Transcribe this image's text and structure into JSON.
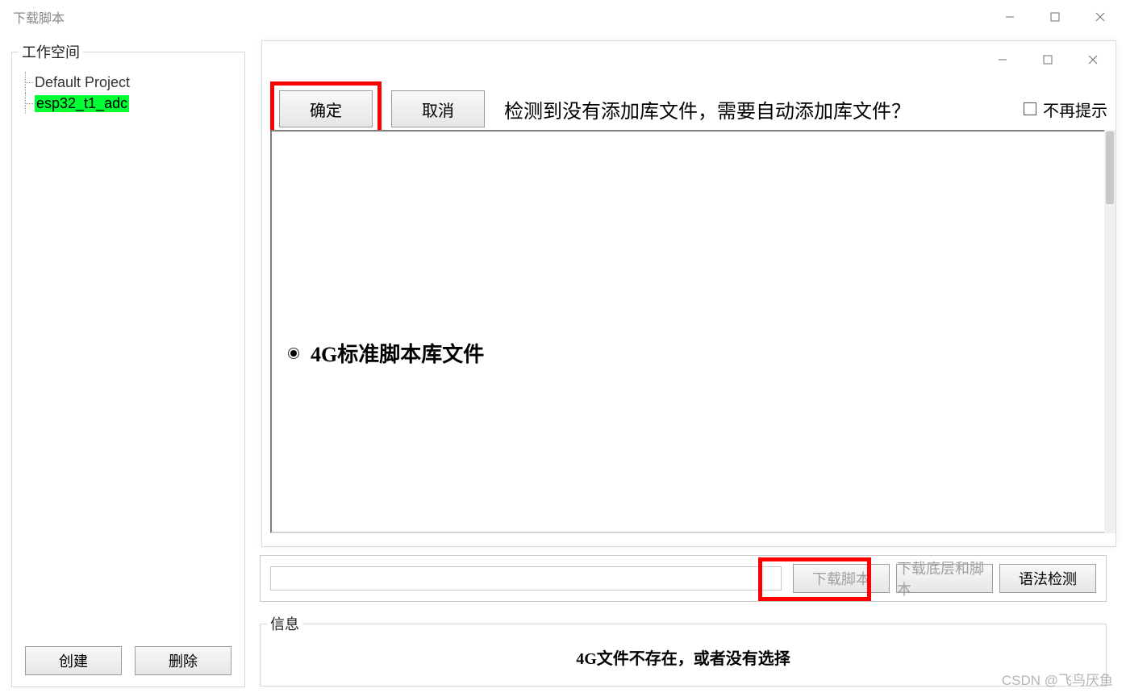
{
  "window": {
    "title": "下载脚本"
  },
  "workspace": {
    "legend": "工作空间",
    "tree": {
      "root": "Default Project",
      "child": "esp32_t1_adc"
    },
    "buttons": {
      "create": "创建",
      "delete": "删除"
    }
  },
  "bottombar": {
    "download_script": "下载脚本",
    "download_base_script": "下载底层和脚本",
    "syntax_check": "语法检测"
  },
  "info": {
    "legend": "信息",
    "message": "4G文件不存在，或者没有选择"
  },
  "dialog": {
    "confirm": "确定",
    "cancel": "取消",
    "message": "检测到没有添加库文件，需要自动添加库文件？",
    "dont_prompt": "不再提示",
    "radio_option": "4G标准脚本库文件"
  },
  "watermark": "CSDN @飞鸟厌鱼"
}
